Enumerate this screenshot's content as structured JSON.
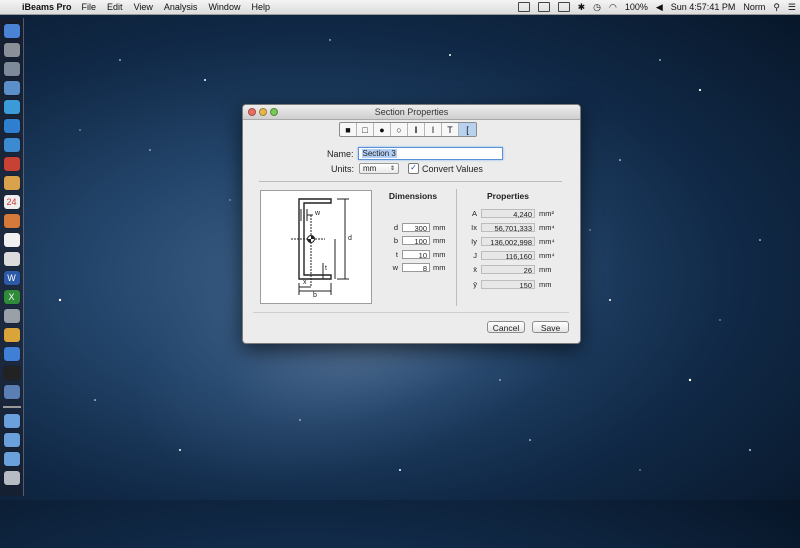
{
  "menubar": {
    "app_name": "iBeams Pro",
    "menus": [
      "File",
      "Edit",
      "View",
      "Analysis",
      "Window",
      "Help"
    ],
    "battery": "100%",
    "clock": "Sun 4:57:41 PM",
    "user": "Norm"
  },
  "dock": {
    "icons": [
      "finder-icon",
      "launchpad-icon",
      "preview-icon",
      "photo-icon",
      "safari-icon",
      "appstore-icon",
      "globe-icon",
      "mail-icon",
      "notes-icon",
      "calendar-icon",
      "photos-icon",
      "textedit-icon",
      "terminal-icon",
      "word-icon",
      "excel-icon",
      "system-icon",
      "pages-icon",
      "xcode-icon",
      "console-icon",
      "ibeams-icon"
    ],
    "stack_icons": [
      "folder-icon",
      "folder-icon",
      "folder-icon",
      "trash-icon"
    ]
  },
  "window": {
    "title": "Section Properties",
    "shape_tools": [
      "■",
      "□",
      "●",
      "○",
      "I",
      "I",
      "T",
      "["
    ],
    "name_label": "Name:",
    "name_value": "Section 3",
    "units_label": "Units:",
    "units_value": "mm",
    "convert_label": "Convert Values",
    "convert_checked": true,
    "dimensions_title": "Dimensions",
    "properties_title": "Properties",
    "dimensions": [
      {
        "key": "d",
        "value": "300",
        "unit": "mm"
      },
      {
        "key": "b",
        "value": "100",
        "unit": "mm"
      },
      {
        "key": "t",
        "value": "10",
        "unit": "mm"
      },
      {
        "key": "w",
        "value": "8",
        "unit": "mm"
      }
    ],
    "properties": [
      {
        "key": "A",
        "value": "4,240",
        "unit": "mm²"
      },
      {
        "key": "Ix",
        "value": "56,701,333",
        "unit": "mm⁴"
      },
      {
        "key": "Iy",
        "value": "136,002,998",
        "unit": "mm⁴"
      },
      {
        "key": "J",
        "value": "116,160",
        "unit": "mm⁴"
      },
      {
        "key": "x̄",
        "value": "26",
        "unit": "mm"
      },
      {
        "key": "ȳ",
        "value": "150",
        "unit": "mm"
      }
    ],
    "diagram_labels": {
      "w": "w",
      "d": "d",
      "x": "x",
      "b": "b",
      "t": "t"
    },
    "cancel_label": "Cancel",
    "save_label": "Save"
  }
}
